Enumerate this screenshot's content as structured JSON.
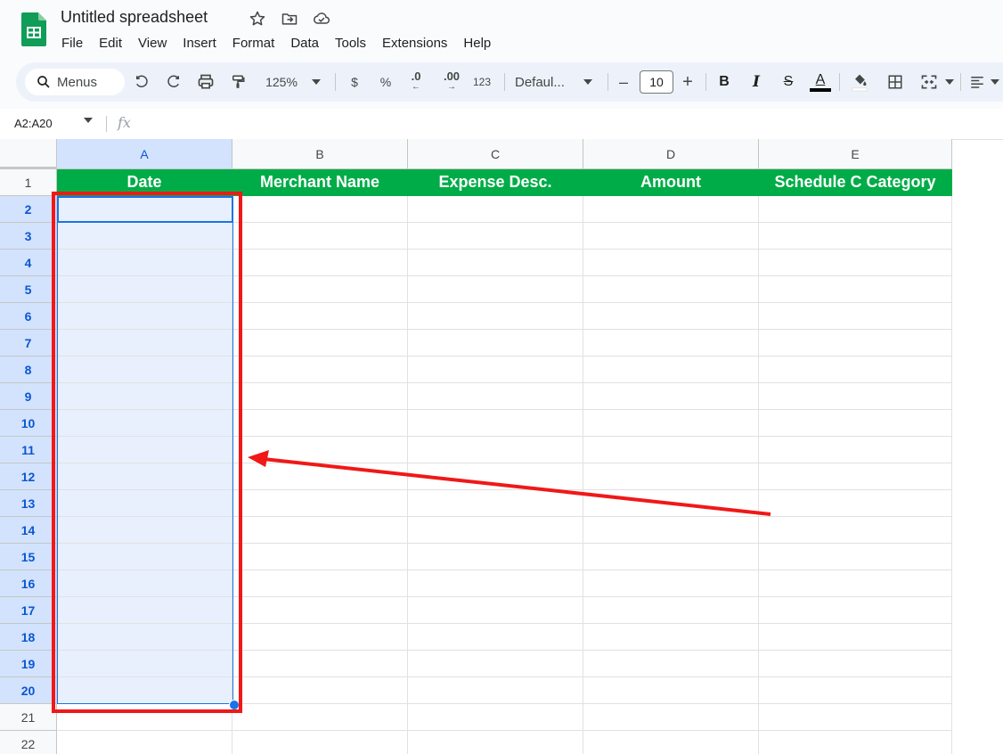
{
  "app": {
    "title": "Untitled spreadsheet",
    "menus": [
      "File",
      "Edit",
      "View",
      "Insert",
      "Format",
      "Data",
      "Tools",
      "Extensions",
      "Help"
    ]
  },
  "toolbar": {
    "search_label": "Menus",
    "zoom": "125%",
    "currency": "$",
    "percent": "%",
    "dec_decrease": ".0",
    "dec_increase": ".00",
    "number_format": "123",
    "font": "Defaul...",
    "minus": "–",
    "font_size": "10",
    "plus": "+",
    "bold": "B",
    "italic": "I",
    "strike": "S",
    "text_color": "A"
  },
  "formula_bar": {
    "name_box": "A2:A20",
    "fx": "fx"
  },
  "grid": {
    "columns": [
      "A",
      "B",
      "C",
      "D",
      "E"
    ],
    "rows": [
      "1",
      "2",
      "3",
      "4",
      "5",
      "6",
      "7",
      "8",
      "9",
      "10",
      "11",
      "12",
      "13",
      "14",
      "15",
      "16",
      "17",
      "18",
      "19",
      "20",
      "21",
      "22"
    ],
    "header_row": [
      "Date",
      "Merchant Name",
      "Expense Desc.",
      "Amount",
      "Schedule C Category"
    ],
    "selected_column": "A",
    "selected_rows": [
      "2",
      "3",
      "4",
      "5",
      "6",
      "7",
      "8",
      "9",
      "10",
      "11",
      "12",
      "13",
      "14",
      "15",
      "16",
      "17",
      "18",
      "19",
      "20"
    ]
  },
  "colors": {
    "header_fill": "#00ac47",
    "selection": "#1a73e8",
    "annotation": "#f01818"
  }
}
